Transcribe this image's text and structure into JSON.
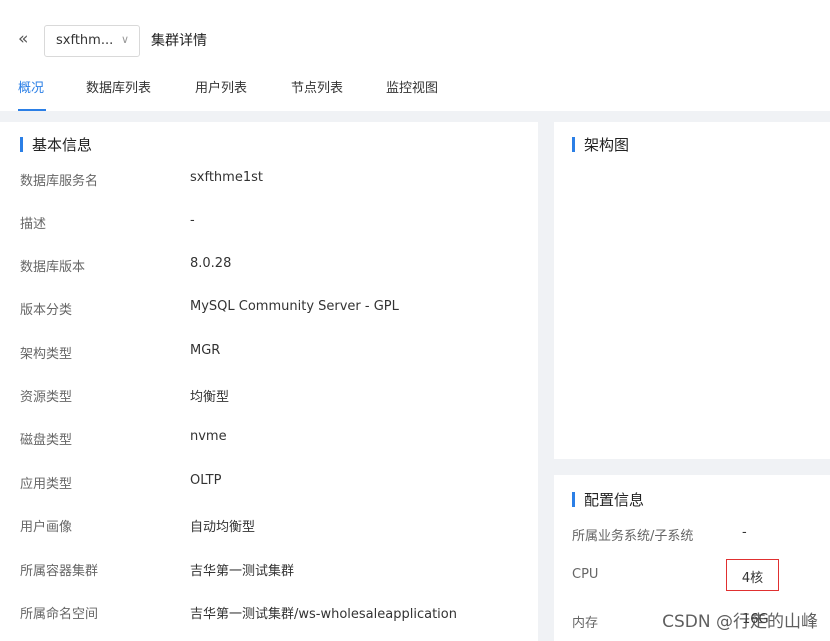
{
  "header": {
    "back_icon": "double-chevron-left-icon",
    "cluster_selector_value": "sxfthm...",
    "dropdown_icon": "chevron-down-icon",
    "title": "集群详情"
  },
  "tabs": [
    {
      "label": "概况",
      "active": true
    },
    {
      "label": "数据库列表",
      "active": false
    },
    {
      "label": "用户列表",
      "active": false
    },
    {
      "label": "节点列表",
      "active": false
    },
    {
      "label": "监控视图",
      "active": false
    }
  ],
  "basic_info": {
    "title": "基本信息",
    "rows": [
      {
        "label": "数据库服务名",
        "value": "sxfthme1st"
      },
      {
        "label": "描述",
        "value": "-"
      },
      {
        "label": "数据库版本",
        "value": "8.0.28"
      },
      {
        "label": "版本分类",
        "value": "MySQL Community Server - GPL"
      },
      {
        "label": "架构类型",
        "value": "MGR"
      },
      {
        "label": "资源类型",
        "value": "均衡型"
      },
      {
        "label": "磁盘类型",
        "value": "nvme"
      },
      {
        "label": "应用类型",
        "value": "OLTP"
      },
      {
        "label": "用户画像",
        "value": "自动均衡型"
      },
      {
        "label": "所属容器集群",
        "value": "吉华第一测试集群"
      },
      {
        "label": "所属命名空间",
        "value": "吉华第一测试集群/ws-wholesaleapplication"
      }
    ]
  },
  "architecture": {
    "title": "架构图"
  },
  "config_info": {
    "title": "配置信息",
    "rows": [
      {
        "label": "所属业务系统/子系统",
        "value": "-"
      },
      {
        "label": "CPU",
        "value": "4核"
      },
      {
        "label": "内存",
        "value": "16G"
      }
    ]
  },
  "colors": {
    "accent": "#2b7fe6",
    "highlight_border": "#e03030",
    "page_background": "#f0f2f5"
  },
  "watermark": "CSDN @行走的山峰"
}
